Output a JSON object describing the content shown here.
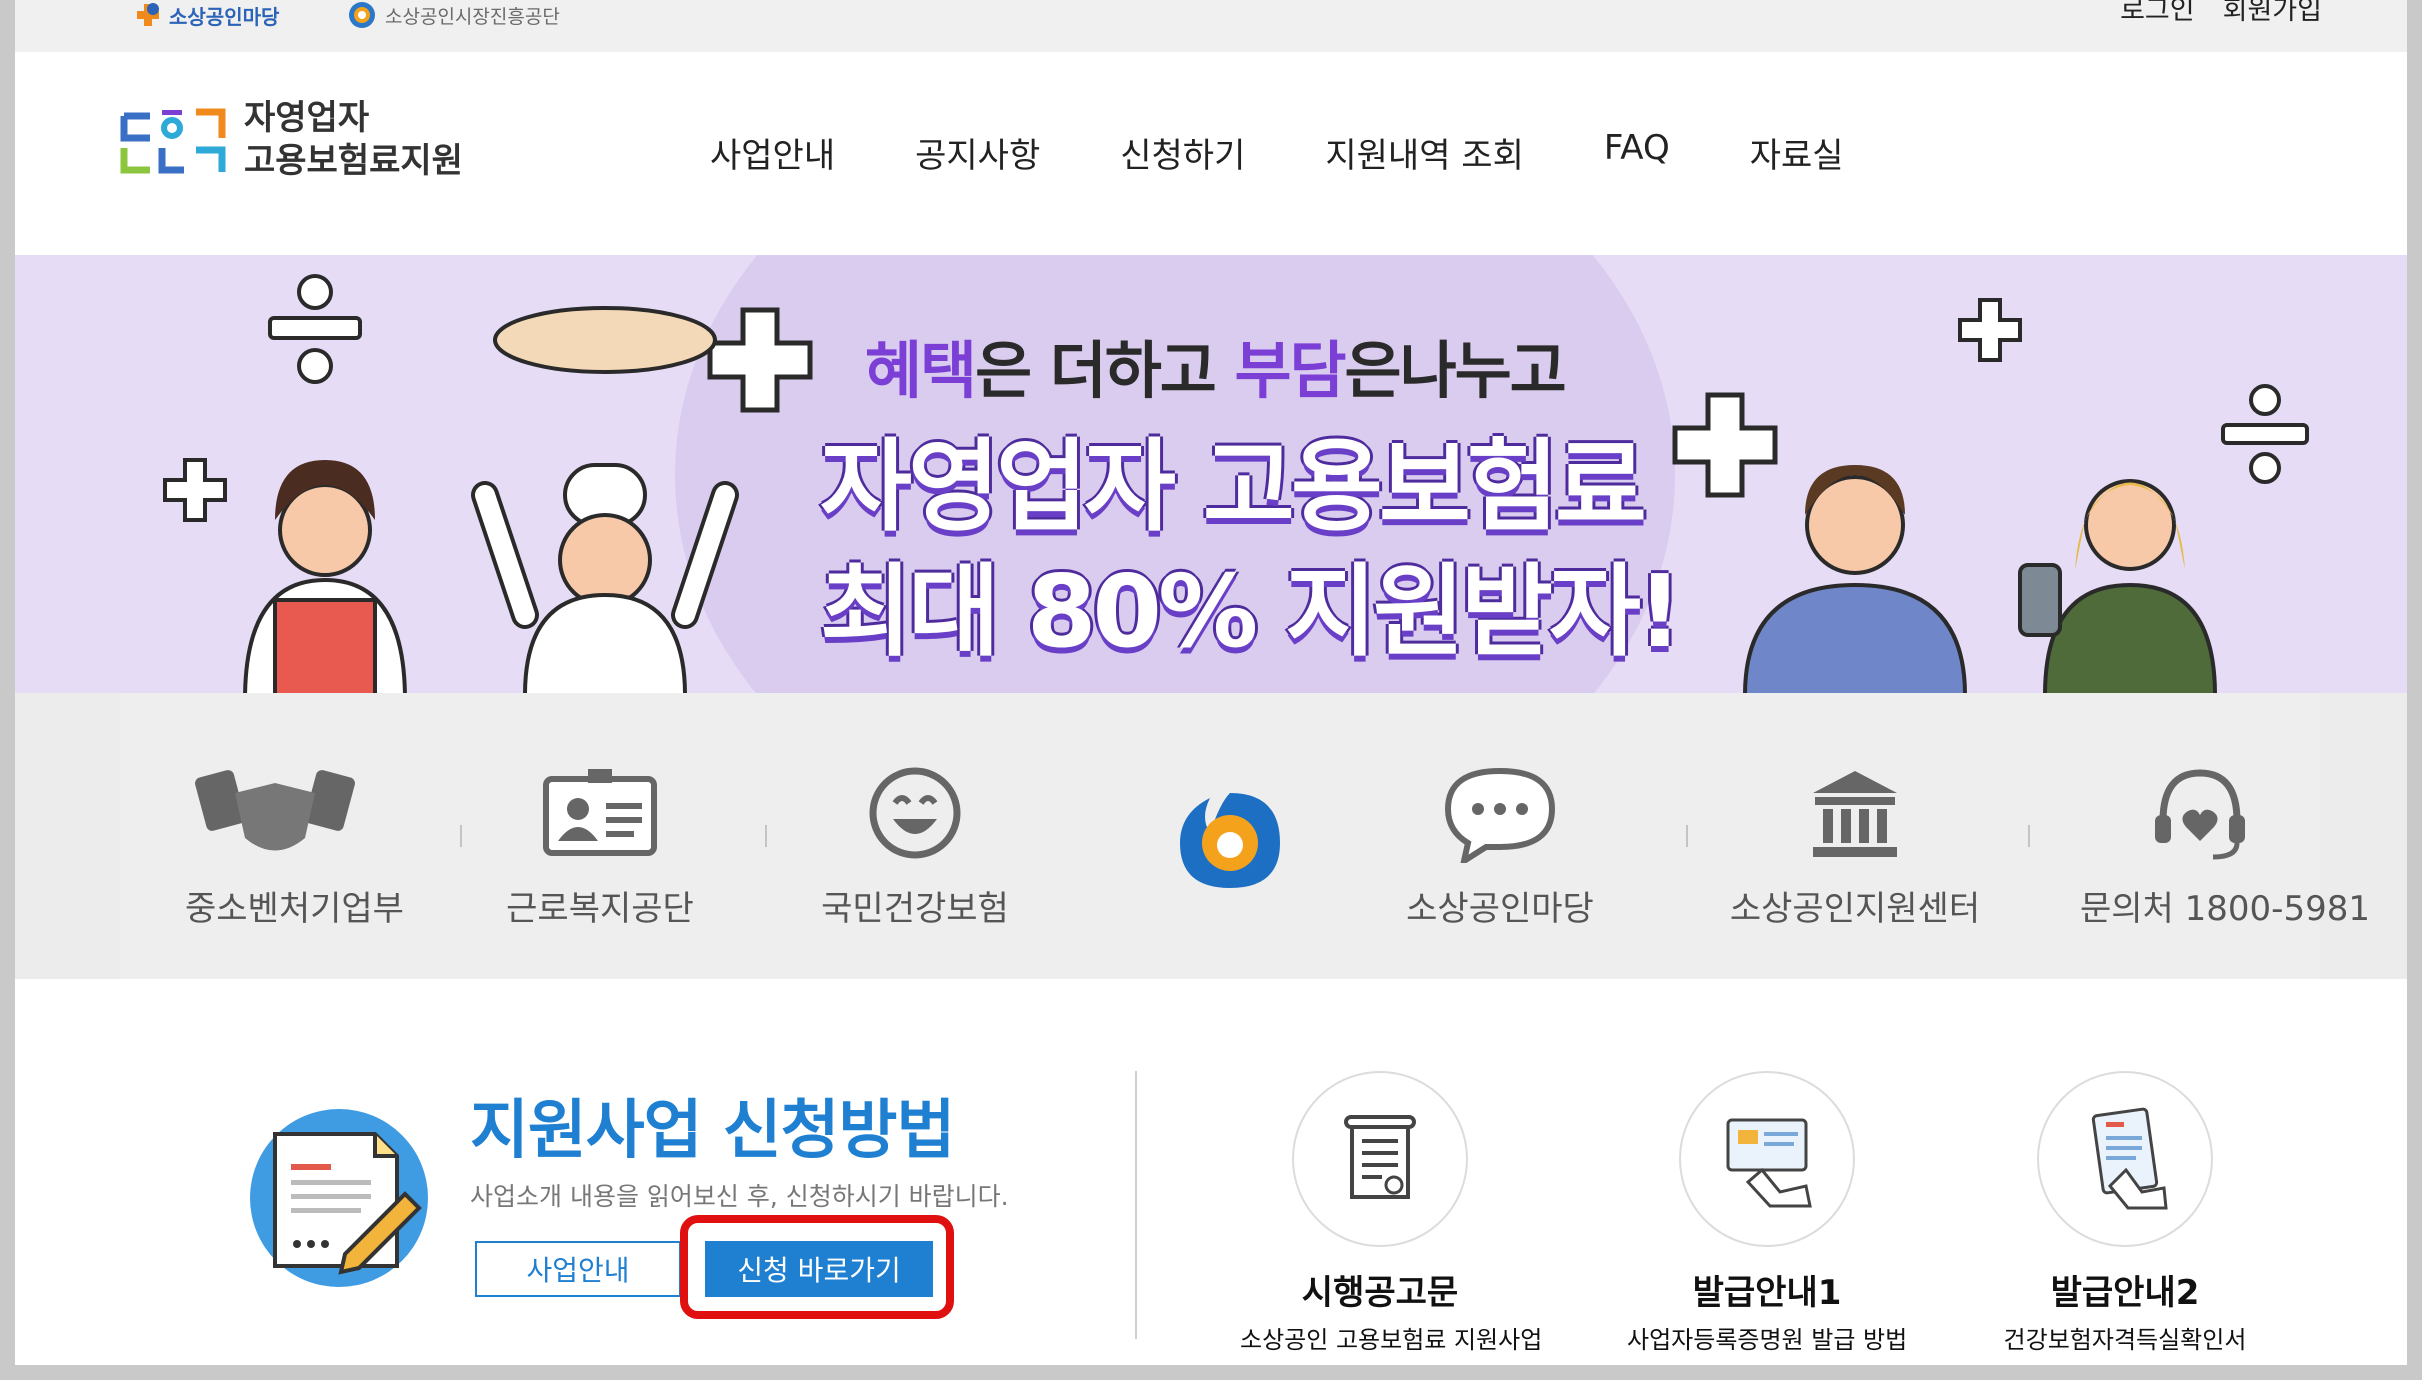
{
  "utility": {
    "site1": "소상공인마당",
    "site2": "소상공인시장진흥공단",
    "login": "로그인",
    "signup": "회원가입"
  },
  "header": {
    "logo_line1": "자영업자",
    "logo_line2": "고용보험료지원",
    "nav": [
      "사업안내",
      "공지사항",
      "신청하기",
      "지원내역 조회",
      "FAQ",
      "자료실"
    ]
  },
  "banner": {
    "line1_a": "혜택",
    "line1_b": "은 더하고 ",
    "line1_c": "부담",
    "line1_d": "은나누고",
    "line2": "자영업자 고용보험료",
    "line3": "최대 80% 지원받자!"
  },
  "links": [
    {
      "label": "중소벤처기업부",
      "icon": "handshake-icon"
    },
    {
      "label": "근로복지공단",
      "icon": "id-card-icon"
    },
    {
      "label": "국민건강보험",
      "icon": "smile-icon"
    },
    {
      "label": "",
      "icon": "semas-logo-icon"
    },
    {
      "label": "소상공인마당",
      "icon": "chat-bubble-icon"
    },
    {
      "label": "소상공인지원센터",
      "icon": "building-icon"
    },
    {
      "label": "문의처 1800-5981",
      "icon": "headset-icon"
    }
  ],
  "apply": {
    "title": "지원사업 신청방법",
    "desc": "사업소개 내용을 읽어보신 후, 신청하시기 바랍니다.",
    "btn_info": "사업안내",
    "btn_apply": "신청 바로가기"
  },
  "cards": [
    {
      "title": "시행공고문",
      "sub": "소상공인 고용보험료 지원사업",
      "icon": "scroll-document-icon"
    },
    {
      "title": "발급안내1",
      "sub": "사업자등록증명원 발급 방법",
      "icon": "certificate-hand-icon"
    },
    {
      "title": "발급안내2",
      "sub": "건강보험자격득실확인서",
      "icon": "phone-document-icon"
    }
  ],
  "colors": {
    "accent_blue": "#1f7fd1",
    "banner_bg": "#e6dcf6",
    "banner_purple": "#7b3fd6",
    "highlight_red": "#e01010"
  }
}
